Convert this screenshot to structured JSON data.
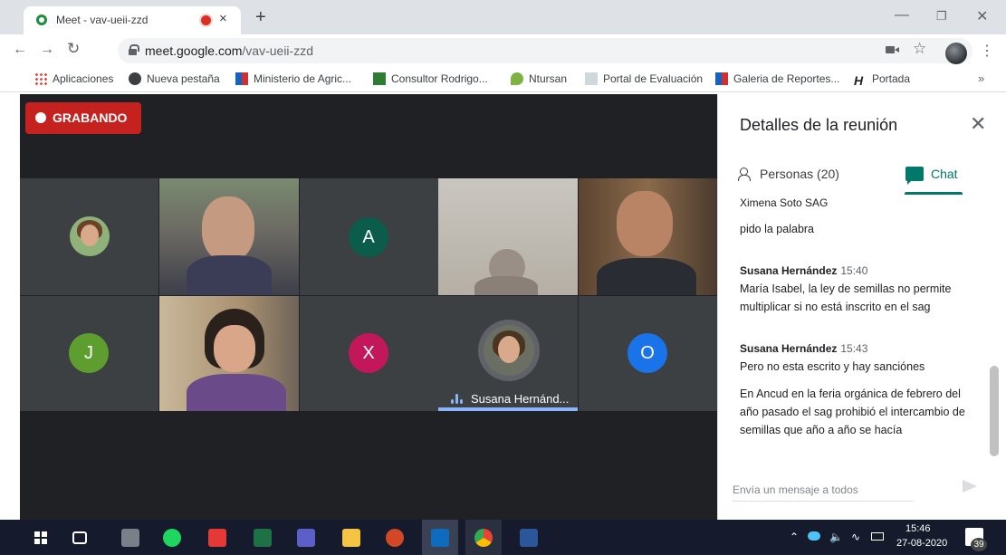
{
  "browser": {
    "tab_title": "Meet - vav-ueii-zzd",
    "new_tab_symbol": "+",
    "close_symbol": "×",
    "url_domain": "meet.google.com",
    "url_path": "/vav-ueii-zzd",
    "bookmarks": [
      {
        "label": "Aplicaciones",
        "icon": "apps-grid-icon",
        "color": "#ea4335"
      },
      {
        "label": "Nueva pestaña",
        "icon": "globe-icon",
        "color": "#3c4043"
      },
      {
        "label": "Ministerio de Agric...",
        "icon": "flag-icon",
        "color": "#d32f2f"
      },
      {
        "label": "Consultor Rodrigo...",
        "icon": "ra-icon",
        "color": "#2e7d32"
      },
      {
        "label": "Ntursan",
        "icon": "leaf-icon",
        "color": "#7cb342"
      },
      {
        "label": "Portal de Evaluación",
        "icon": "doc-icon",
        "color": "#90a4ae"
      },
      {
        "label": "Galeria de Reportes...",
        "icon": "flag-icon",
        "color": "#1565c0"
      },
      {
        "label": "Portada",
        "icon": "h-icon",
        "color": "#202124"
      }
    ],
    "bookmarks_more": "»"
  },
  "meet": {
    "recording_label": "GRABANDO",
    "tiles": [
      {
        "kind": "photo"
      },
      {
        "kind": "video"
      },
      {
        "kind": "initial",
        "initial": "A",
        "color": "#0b5c4a"
      },
      {
        "kind": "video"
      },
      {
        "kind": "video"
      },
      {
        "kind": "initial",
        "initial": "J",
        "color": "#5e9e2f"
      },
      {
        "kind": "video"
      },
      {
        "kind": "initial",
        "initial": "X",
        "color": "#c2185b"
      },
      {
        "kind": "speaker",
        "label": "Susana Hernánd..."
      },
      {
        "kind": "initial",
        "initial": "O",
        "color": "#1a73e8"
      }
    ]
  },
  "panel": {
    "title": "Detalles de la reunión",
    "people_tab": "Personas (20)",
    "chat_tab": "Chat",
    "accent": "#00796b",
    "messages": [
      {
        "sender": "Ximena Soto SAG",
        "time": "",
        "texts": [
          "pido la palabra"
        ]
      },
      {
        "sender": "Susana Hernández",
        "time": "15:40",
        "texts": [
          "María Isabel, la ley de semillas no permite multiplicar si no está inscrito en el sag"
        ]
      },
      {
        "sender": "Susana Hernández",
        "time": "15:43",
        "texts": [
          "Pero no esta escrito y hay sanciónes",
          "En Ancud en la feria orgánica de febrero del año pasado el sag prohibió el intercambio de semillas que año a año se hacía"
        ]
      }
    ],
    "composer_placeholder": "Envía un mensaje a todos"
  },
  "taskbar": {
    "time": "15:46",
    "date": "27-08-2020",
    "notifications": "39",
    "apps": [
      {
        "name": "task-view-icon",
        "color": "#ffffff"
      },
      {
        "name": "calculator-icon",
        "color": "#7a7f8a"
      },
      {
        "name": "spotify-icon",
        "color": "#1ed760"
      },
      {
        "name": "acrobat-icon",
        "color": "#e53935"
      },
      {
        "name": "excel-icon",
        "color": "#1e7145"
      },
      {
        "name": "teams-icon",
        "color": "#5b5fc7"
      },
      {
        "name": "file-explorer-icon",
        "color": "#f4c542"
      },
      {
        "name": "powerpoint-icon",
        "color": "#d24726"
      },
      {
        "name": "outlook-icon",
        "color": "#0f6cbd"
      },
      {
        "name": "chrome-icon",
        "color": "#4285f4"
      },
      {
        "name": "word-icon",
        "color": "#2b579a"
      }
    ]
  }
}
